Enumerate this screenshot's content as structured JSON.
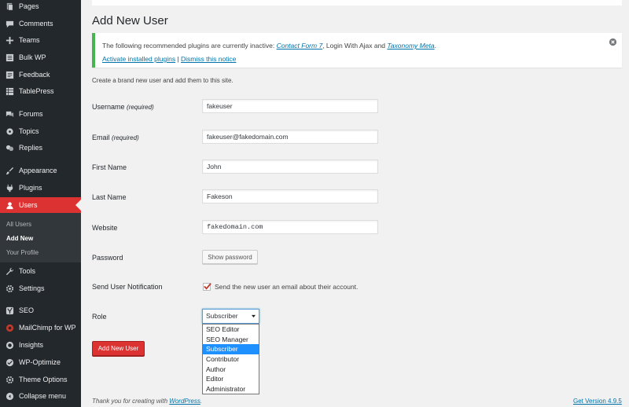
{
  "sidebar": {
    "items": [
      {
        "label": "Pages",
        "icon": "pages-icon"
      },
      {
        "label": "Comments",
        "icon": "comments-icon"
      },
      {
        "label": "Teams",
        "icon": "plus-icon"
      },
      {
        "label": "Bulk WP",
        "icon": "bulk-icon"
      },
      {
        "label": "Feedback",
        "icon": "feedback-icon"
      },
      {
        "label": "TablePress",
        "icon": "table-icon"
      },
      {
        "label": "Forums",
        "icon": "forums-icon"
      },
      {
        "label": "Topics",
        "icon": "topics-icon"
      },
      {
        "label": "Replies",
        "icon": "replies-icon"
      },
      {
        "label": "Appearance",
        "icon": "appearance-icon"
      },
      {
        "label": "Plugins",
        "icon": "plugins-icon"
      },
      {
        "label": "Users",
        "icon": "users-icon"
      },
      {
        "label": "Tools",
        "icon": "tools-icon"
      },
      {
        "label": "Settings",
        "icon": "settings-icon"
      },
      {
        "label": "SEO",
        "icon": "seo-icon"
      },
      {
        "label": "MailChimp for WP",
        "icon": "mailchimp-icon"
      },
      {
        "label": "Insights",
        "icon": "insights-icon"
      },
      {
        "label": "WP-Optimize",
        "icon": "wp-optimize-icon"
      },
      {
        "label": "Theme Options",
        "icon": "theme-options-icon"
      },
      {
        "label": "Collapse menu",
        "icon": "collapse-icon"
      }
    ],
    "submenu": [
      "All Users",
      "Add New",
      "Your Profile"
    ],
    "active_color": "#dc3232"
  },
  "page": {
    "title": "Add New User",
    "intro": "Create a brand new user and add them to this site."
  },
  "notice": {
    "text_before": "The following recommended plugins are currently inactive: ",
    "plugin1": "Contact Form 7",
    "text_mid": ", Login With Ajax and ",
    "plugin2": "Taxonomy Meta",
    "text_end": ".",
    "activate_link": "Activate installed plugins",
    "separator": " | ",
    "dismiss_link": "Dismiss this notice"
  },
  "form": {
    "username_label": "Username",
    "email_label": "Email",
    "required_note": "(required)",
    "username_value": "fakeuser",
    "email_value": "fakeuser@fakedomain.com",
    "first_name_label": "First Name",
    "first_name_value": "John",
    "last_name_label": "Last Name",
    "last_name_value": "Fakeson",
    "website_label": "Website",
    "website_value": "fakedomain.com",
    "password_label": "Password",
    "show_password_button": "Show password",
    "notification_label": "Send User Notification",
    "notification_text": "Send the new user an email about their account.",
    "role_label": "Role",
    "role_selected": "Subscriber",
    "role_options": [
      "SEO Editor",
      "SEO Manager",
      "Subscriber",
      "Contributor",
      "Author",
      "Editor",
      "Administrator"
    ],
    "submit_button": "Add New User"
  },
  "footer": {
    "thanks_text": "Thank you for creating with ",
    "wordpress_link": "WordPress",
    "period": ".",
    "version_link": "Get Version 4.9.5"
  }
}
